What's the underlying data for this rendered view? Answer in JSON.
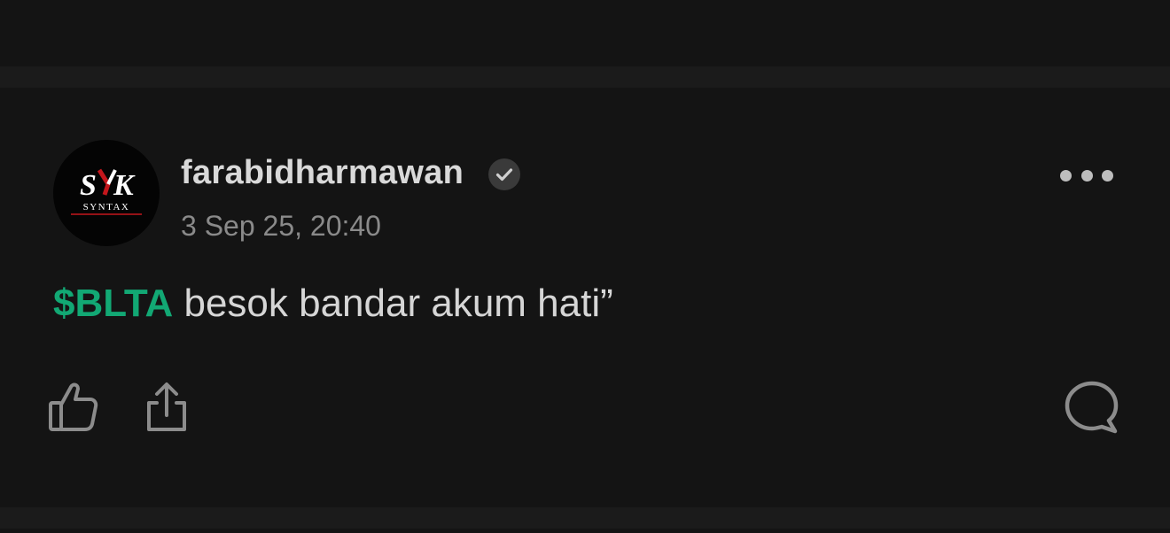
{
  "post": {
    "author": {
      "name": "farabidharmawan",
      "verified": true,
      "avatar_text_top": "SYK",
      "avatar_text_bottom": "SYNTAX"
    },
    "timestamp": "3 Sep 25, 20:40",
    "content": {
      "ticker": "$BLTA",
      "text": " besok bandar akum hati”"
    },
    "actions": {
      "like_icon": "thumbs-up-icon",
      "share_icon": "share-icon",
      "comment_icon": "comment-icon",
      "more_icon": "more-options-icon"
    }
  },
  "colors": {
    "background": "#141414",
    "divider": "#1b1b1b",
    "ticker_accent": "#12a874",
    "author_name": "#d9d9d9",
    "timestamp": "#8a8a8a",
    "body_text": "#d6d6d6",
    "icon": "#8c8c8c"
  }
}
